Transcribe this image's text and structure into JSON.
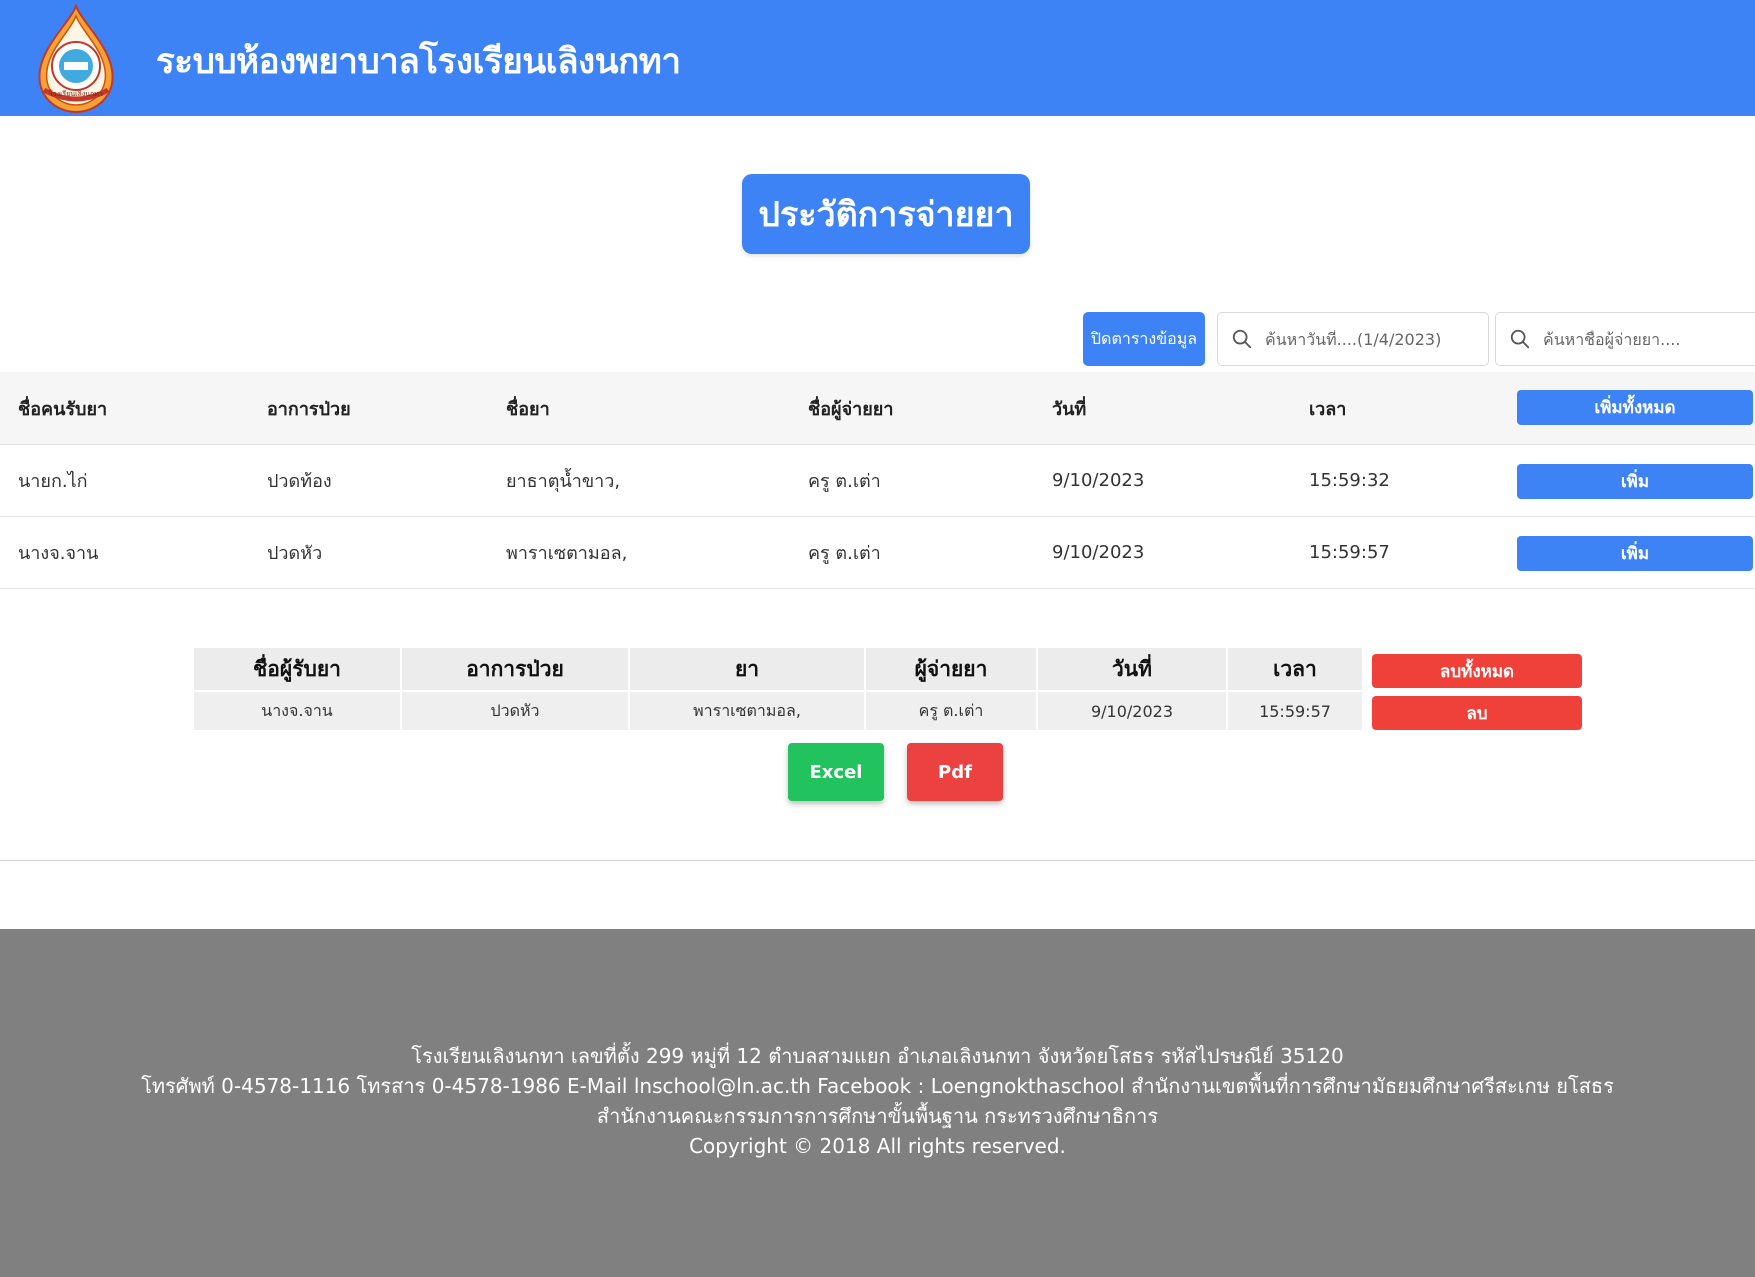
{
  "header": {
    "title": "ระบบห้องพยาบาลโรงเรียนเลิงนกทา",
    "logo_text": "โรงเรียนเลิงนกทา"
  },
  "page_title": "ประวัติการจ่ายยา",
  "toolbar": {
    "close_table_label": "ปิดตารางข้อมูล",
    "date_search_placeholder": "ค้นหาวันที่....(1/4/2023)",
    "name_search_placeholder": "ค้นหาชื่อผู้จ่ายยา...."
  },
  "main_table": {
    "headers": [
      "ชื่อคนรับยา",
      "อาการป่วย",
      "ชื่อยา",
      "ชื่อผู้จ่ายยา",
      "วันที่",
      "เวลา"
    ],
    "add_all_label": "เพิ่มทั้งหมด",
    "add_label": "เพิ่ม",
    "rows": [
      [
        "นายก.ไก่",
        "ปวดท้อง",
        "ยาธาตุน้ำขาว,",
        "ครู ต.เต่า",
        "9/10/2023",
        "15:59:32"
      ],
      [
        "นางจ.จาน",
        "ปวดหัว",
        "พาราเซตามอล,",
        "ครู ต.เต่า",
        "9/10/2023",
        "15:59:57"
      ]
    ]
  },
  "selected_table": {
    "headers": [
      "ชื่อผู้รับยา",
      "อาการป่วย",
      "ยา",
      "ผู้จ่ายยา",
      "วันที่",
      "เวลา"
    ],
    "delete_all_label": "ลบทั้งหมด",
    "delete_label": "ลบ",
    "rows": [
      [
        "นางจ.จาน",
        "ปวดหัว",
        "พาราเซตามอล,",
        "ครู ต.เต่า",
        "9/10/2023",
        "15:59:57"
      ]
    ]
  },
  "export": {
    "excel_label": "Excel",
    "pdf_label": "Pdf"
  },
  "footer": {
    "line1": "โรงเรียนเลิงนกทา เลขที่ตั้ง 299 หมู่ที่ 12 ตำบลสามแยก อำเภอเลิงนกทา จังหวัดยโสธร รหัสไปรษณีย์ 35120",
    "line2": "โทรศัพท์ 0-4578-1116 โทรสาร 0-4578-1986 E-Mail lnschool@ln.ac.th Facebook : Loengnokthaschool สำนักงานเขตพื้นที่การศึกษามัธยมศึกษาศรีสะเกษ ยโสธร",
    "line3": "สำนักงานคณะกรรมการการศึกษาขั้นพื้นฐาน กระทรวงศึกษาธิการ",
    "line4": "Copyright © 2018 All rights reserved."
  },
  "colors": {
    "primary": "#3e83f5",
    "danger": "#f0403a",
    "success": "#22c35e",
    "footer": "#808080"
  }
}
